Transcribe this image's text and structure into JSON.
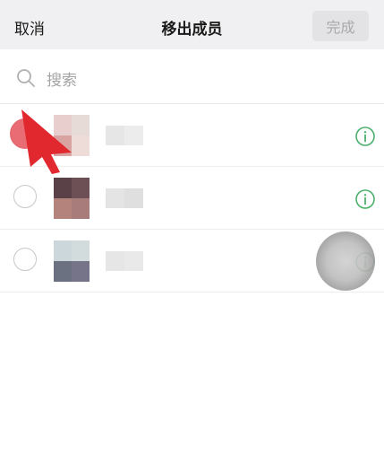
{
  "header": {
    "cancel_label": "取消",
    "title": "移出成员",
    "done_label": "完成"
  },
  "search": {
    "placeholder": "搜索",
    "icon": "search-icon"
  },
  "members": [
    {
      "selected": true,
      "avatar_colors": [
        "#e8cfcd",
        "#e6dbd7",
        "#d9a3a2",
        "#eedcd8"
      ],
      "name_colors": [
        "#e6e6e6",
        "#ececec"
      ]
    },
    {
      "selected": false,
      "avatar_colors": [
        "#5a4148",
        "#6c5055",
        "#b3837c",
        "#a87c7b"
      ],
      "name_colors": [
        "#e4e4e4",
        "#dfdfdf"
      ]
    },
    {
      "selected": false,
      "avatar_colors": [
        "#cbd7da",
        "#d3dcdc",
        "#6c7182",
        "#757489"
      ],
      "name_colors": [
        "#e6e6e6",
        "#e9e9e9"
      ]
    }
  ],
  "colors": {
    "accent_green": "#4ab06b",
    "selected_red": "#e96b74",
    "pointer_red": "#e1282e"
  }
}
